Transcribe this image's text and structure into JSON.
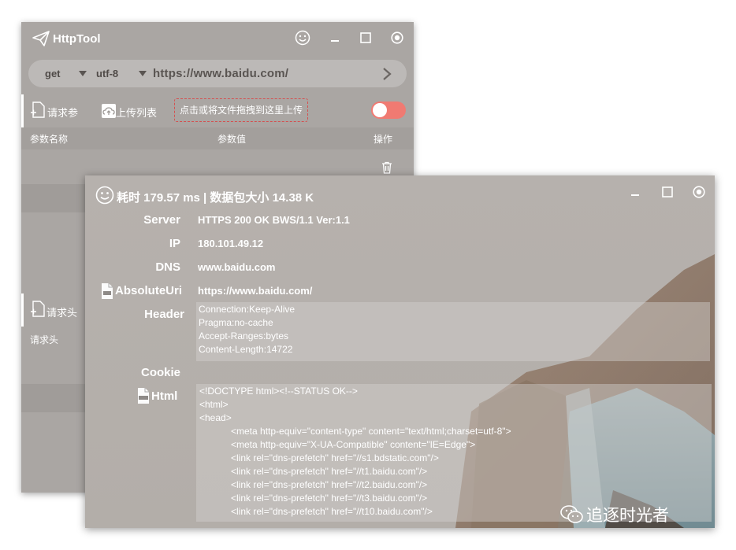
{
  "back_window": {
    "title": "HttpTool",
    "method": "get",
    "encoding": "utf-8",
    "url": "https://www.baidu.com/",
    "tabs": {
      "params_label": "请求参",
      "upload_list_label": "上传列表",
      "headers_label": "请求头"
    },
    "dropzone_text": "点击或将文件拖拽到这里上传",
    "columns": {
      "name": "参数名称",
      "value": "参数值",
      "action": "操作"
    },
    "headers_section_label": "请求头",
    "toggle_on": false
  },
  "front_window": {
    "summary": "耗时 179.57 ms | 数据包大小 14.38 K",
    "fields": {
      "server_label": "Server",
      "server_value": "HTTPS 200 OK BWS/1.1 Ver:1.1",
      "ip_label": "IP",
      "ip_value": "180.101.49.12",
      "dns_label": "DNS",
      "dns_value": "www.baidu.com",
      "absuri_label": "AbsoluteUri",
      "absuri_value": "https://www.baidu.com/",
      "header_label": "Header",
      "cookie_label": "Cookie",
      "html_label": "Html"
    },
    "header_lines": [
      "Connection:Keep-Alive",
      "Pragma:no-cache",
      "Accept-Ranges:bytes",
      "Content-Length:14722"
    ],
    "html_lines": [
      "<!DOCTYPE html><!--STATUS OK-->",
      "<html>",
      "<head>",
      "            <meta http-equiv=\"content-type\" content=\"text/html;charset=utf-8\">",
      "            <meta http-equiv=\"X-UA-Compatible\" content=\"IE=Edge\">",
      "            <link rel=\"dns-prefetch\" href=\"//s1.bdstatic.com\"/>",
      "            <link rel=\"dns-prefetch\" href=\"//t1.baidu.com\"/>",
      "            <link rel=\"dns-prefetch\" href=\"//t2.baidu.com\"/>",
      "            <link rel=\"dns-prefetch\" href=\"//t3.baidu.com\"/>",
      "            <link rel=\"dns-prefetch\" href=\"//t10.baidu.com\"/>"
    ]
  },
  "watermark": "追逐时光者",
  "colors": {
    "window_bg": "#aaa6a3",
    "toggle": "#f07a72",
    "dropzone_border": "#d45050"
  }
}
